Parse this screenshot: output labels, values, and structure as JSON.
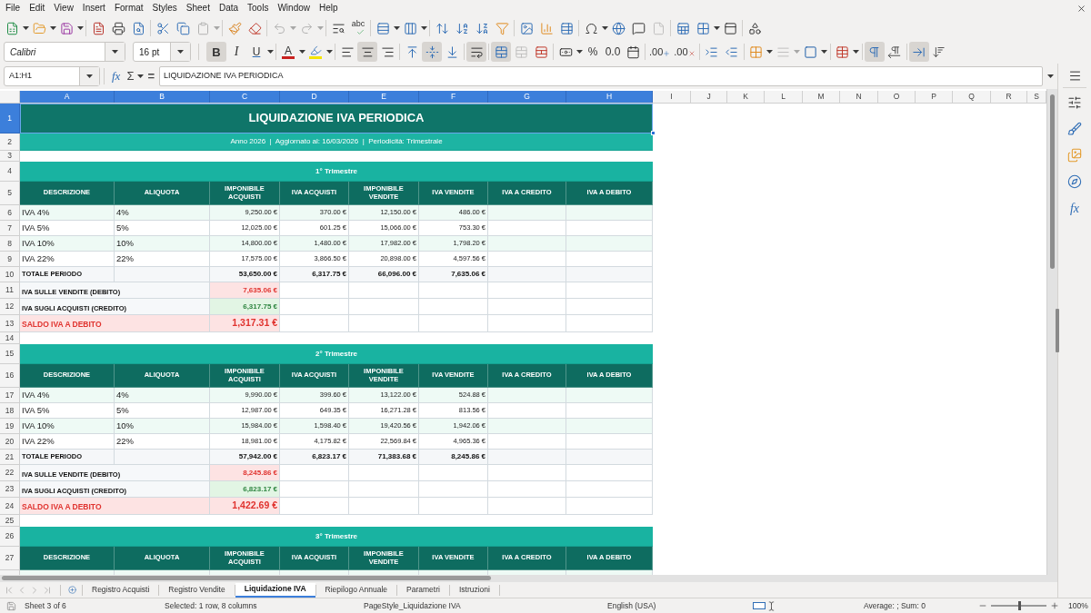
{
  "menu": [
    "File",
    "Edit",
    "View",
    "Insert",
    "Format",
    "Styles",
    "Sheet",
    "Data",
    "Tools",
    "Window",
    "Help"
  ],
  "standard_toolbar": [
    [
      {
        "kind": "new",
        "dropdown": true,
        "disabled": false
      },
      {
        "kind": "open",
        "dropdown": true,
        "disabled": false
      },
      {
        "kind": "save",
        "dropdown": true,
        "disabled": false
      }
    ],
    [
      {
        "kind": "export_pdf",
        "disabled": false
      },
      {
        "kind": "print",
        "disabled": false
      },
      {
        "kind": "print_preview",
        "disabled": false
      }
    ],
    [
      {
        "kind": "cut",
        "disabled": false
      },
      {
        "kind": "copy",
        "disabled": false
      },
      {
        "kind": "paste",
        "dropdown": true,
        "disabled": true
      }
    ],
    [
      {
        "kind": "clone_formatting",
        "disabled": false
      },
      {
        "kind": "clear_formatting",
        "disabled": false
      }
    ],
    [
      {
        "kind": "undo",
        "dropdown": true,
        "disabled": true
      },
      {
        "kind": "redo",
        "dropdown": true,
        "disabled": true
      }
    ],
    [
      {
        "kind": "find_replace",
        "disabled": false
      },
      {
        "kind": "spelling",
        "label": "abc",
        "disabled": false
      }
    ],
    [
      {
        "kind": "rows",
        "dropdown": true,
        "disabled": false
      },
      {
        "kind": "columns",
        "dropdown": true,
        "disabled": false
      }
    ],
    [
      {
        "kind": "sort",
        "disabled": false
      },
      {
        "kind": "sort_ascending",
        "disabled": false
      },
      {
        "kind": "sort_descending",
        "disabled": false
      },
      {
        "kind": "autofilter",
        "disabled": false
      }
    ],
    [
      {
        "kind": "image",
        "disabled": false
      },
      {
        "kind": "chart",
        "disabled": false
      },
      {
        "kind": "pivot_table",
        "disabled": false
      }
    ],
    [
      {
        "kind": "special_character",
        "dropdown": true,
        "disabled": false
      },
      {
        "kind": "hyperlink",
        "disabled": false
      },
      {
        "kind": "comment",
        "disabled": false
      },
      {
        "kind": "header_footer",
        "disabled": true
      }
    ],
    [
      {
        "kind": "print_area",
        "disabled": false
      },
      {
        "kind": "freeze",
        "dropdown": true,
        "disabled": false
      },
      {
        "kind": "split_window",
        "disabled": false
      }
    ],
    [
      {
        "kind": "shapes",
        "disabled": false
      }
    ]
  ],
  "format_toolbar": {
    "font_name": "Calibri",
    "font_size": "16 pt",
    "groups": [
      [
        {
          "kind": "bold",
          "label": "B",
          "active": true,
          "disabled": false
        },
        {
          "kind": "italic",
          "label": "I",
          "active": false,
          "disabled": false
        },
        {
          "kind": "underline",
          "label": "U",
          "active": false,
          "disabled": false,
          "dropdown": true
        }
      ],
      [
        {
          "kind": "font_color",
          "label": "A",
          "active": false,
          "disabled": false,
          "dropdown": true
        },
        {
          "kind": "highlight",
          "active": false,
          "disabled": false,
          "dropdown": true
        }
      ],
      [
        {
          "kind": "align_left",
          "active": false,
          "disabled": false
        },
        {
          "kind": "align_center",
          "active": true,
          "disabled": false
        },
        {
          "kind": "align_right",
          "active": false,
          "disabled": false
        }
      ],
      [
        {
          "kind": "align_top",
          "active": false,
          "disabled": false
        },
        {
          "kind": "align_middle",
          "active": true,
          "disabled": false
        },
        {
          "kind": "align_bottom",
          "active": false,
          "disabled": false
        }
      ],
      [
        {
          "kind": "wrap_text",
          "active": true,
          "disabled": false
        }
      ],
      [
        {
          "kind": "merge_center",
          "active": true,
          "disabled": false
        },
        {
          "kind": "merge_cells",
          "active": false,
          "disabled": true
        },
        {
          "kind": "unmerge_cells",
          "active": false,
          "disabled": false
        }
      ],
      [
        {
          "kind": "currency",
          "active": false,
          "disabled": false,
          "dropdown": true
        },
        {
          "kind": "percent",
          "label": "%",
          "active": false,
          "disabled": false
        },
        {
          "kind": "number",
          "label": "0.0",
          "active": false,
          "disabled": false
        },
        {
          "kind": "date",
          "active": false,
          "disabled": false
        }
      ],
      [
        {
          "kind": "add_decimal",
          "label": ".00",
          "active": false,
          "disabled": false
        },
        {
          "kind": "delete_decimal",
          "label": ".00",
          "active": false,
          "disabled": false
        }
      ],
      [
        {
          "kind": "indent",
          "active": false,
          "disabled": false
        },
        {
          "kind": "outdent",
          "active": false,
          "disabled": false
        }
      ],
      [
        {
          "kind": "borders",
          "active": false,
          "disabled": false,
          "dropdown": true
        },
        {
          "kind": "border_style",
          "active": false,
          "disabled": true,
          "dropdown": true
        },
        {
          "kind": "border_color",
          "active": false,
          "disabled": false,
          "dropdown": true
        }
      ],
      [
        {
          "kind": "conditional",
          "active": false,
          "disabled": false,
          "dropdown": true
        }
      ],
      [
        {
          "kind": "left_to_right",
          "active": true,
          "disabled": false
        },
        {
          "kind": "right_to_left",
          "active": false,
          "disabled": false
        }
      ],
      [
        {
          "kind": "text_left_to_right",
          "active": true,
          "disabled": false
        },
        {
          "kind": "text_top_to_bottom",
          "active": false,
          "disabled": false
        }
      ]
    ]
  },
  "formula_bar": {
    "name_box": "A1:H1",
    "wizard_label": "fx",
    "sum_label": "Σ",
    "equals_label": "=",
    "content": "LIQUIDAZIONE IVA PERIODICA"
  },
  "sheet": {
    "column_headers": [
      {
        "label": "A",
        "selected": true
      },
      {
        "label": "B",
        "selected": true
      },
      {
        "label": "C",
        "selected": true
      },
      {
        "label": "D",
        "selected": true
      },
      {
        "label": "E",
        "selected": true
      },
      {
        "label": "F",
        "selected": true
      },
      {
        "label": "G",
        "selected": true
      },
      {
        "label": "H",
        "selected": true
      },
      {
        "label": "I",
        "selected": false
      },
      {
        "label": "J",
        "selected": false
      },
      {
        "label": "K",
        "selected": false
      },
      {
        "label": "L",
        "selected": false
      },
      {
        "label": "M",
        "selected": false
      },
      {
        "label": "N",
        "selected": false
      },
      {
        "label": "O",
        "selected": false
      },
      {
        "label": "P",
        "selected": false
      },
      {
        "label": "Q",
        "selected": false
      },
      {
        "label": "R",
        "selected": false
      },
      {
        "label": "S",
        "selected": false
      }
    ],
    "row_headers": [
      {
        "label": "1",
        "selected": true
      },
      {
        "label": "2",
        "selected": false
      },
      {
        "label": "3",
        "selected": false
      },
      {
        "label": "4",
        "selected": false
      },
      {
        "label": "5",
        "selected": false
      },
      {
        "label": "6",
        "selected": false
      },
      {
        "label": "7",
        "selected": false
      },
      {
        "label": "8",
        "selected": false
      },
      {
        "label": "9",
        "selected": false
      },
      {
        "label": "10",
        "selected": false
      },
      {
        "label": "11",
        "selected": false
      },
      {
        "label": "12",
        "selected": false
      },
      {
        "label": "13",
        "selected": false
      },
      {
        "label": "14",
        "selected": false
      },
      {
        "label": "15",
        "selected": false
      },
      {
        "label": "16",
        "selected": false
      },
      {
        "label": "17",
        "selected": false
      },
      {
        "label": "18",
        "selected": false
      },
      {
        "label": "19",
        "selected": false
      },
      {
        "label": "20",
        "selected": false
      },
      {
        "label": "21",
        "selected": false
      },
      {
        "label": "22",
        "selected": false
      },
      {
        "label": "23",
        "selected": false
      },
      {
        "label": "24",
        "selected": false
      },
      {
        "label": "25",
        "selected": false
      },
      {
        "label": "26",
        "selected": false
      },
      {
        "label": "27",
        "selected": false
      }
    ],
    "title": "LIQUIDAZIONE IVA PERIODICA",
    "subtitle": "Anno 2026  |  Aggiornato al: 16/03/2026  |  Periodicità: Trimestrale",
    "quarters": [
      {
        "title": "1° Trimestre",
        "columns": [
          "DESCRIZIONE",
          "ALIQUOTA",
          "IMPONIBILE ACQUISTI",
          "IVA ACQUISTI",
          "IMPONIBILE VENDITE",
          "IVA VENDITE",
          "IVA A CREDITO",
          "IVA A DEBITO"
        ],
        "rows": [
          [
            "IVA 4%",
            "4%",
            "9,250.00 €",
            "370.00 €",
            "12,150.00 €",
            "486.00 €"
          ],
          [
            "IVA 5%",
            "5%",
            "12,025.00 €",
            "601.25 €",
            "15,066.00 €",
            "753.30 €"
          ],
          [
            "IVA 10%",
            "10%",
            "14,800.00 €",
            "1,480.00 €",
            "17,982.00 €",
            "1,798.20 €"
          ],
          [
            "IVA 22%",
            "22%",
            "17,575.00 €",
            "3,866.50 €",
            "20,898.00 €",
            "4,597.56 €"
          ]
        ],
        "total": {
          "label": "TOTALE PERIODO",
          "values": [
            "53,650.00 €",
            "6,317.75 €",
            "66,096.00 €",
            "7,635.06 €"
          ]
        },
        "summary": [
          {
            "kind": "debit",
            "label": "IVA SULLE VENDITE (DEBITO)",
            "value": "7,635.06 €"
          },
          {
            "kind": "credit",
            "label": "IVA SUGLI ACQUISTI (CREDITO)",
            "value": "6,317.75 €"
          },
          {
            "kind": "balance",
            "label": "SALDO IVA A DEBITO",
            "value": "1,317.31 €"
          }
        ]
      },
      {
        "title": "2° Trimestre",
        "columns": [
          "DESCRIZIONE",
          "ALIQUOTA",
          "IMPONIBILE ACQUISTI",
          "IVA ACQUISTI",
          "IMPONIBILE VENDITE",
          "IVA VENDITE",
          "IVA A CREDITO",
          "IVA A DEBITO"
        ],
        "rows": [
          [
            "IVA 4%",
            "4%",
            "9,990.00 €",
            "399.60 €",
            "13,122.00 €",
            "524.88 €"
          ],
          [
            "IVA 5%",
            "5%",
            "12,987.00 €",
            "649.35 €",
            "16,271.28 €",
            "813.56 €"
          ],
          [
            "IVA 10%",
            "10%",
            "15,984.00 €",
            "1,598.40 €",
            "19,420.56 €",
            "1,942.06 €"
          ],
          [
            "IVA 22%",
            "22%",
            "18,981.00 €",
            "4,175.82 €",
            "22,569.84 €",
            "4,965.36 €"
          ]
        ],
        "total": {
          "label": "TOTALE PERIODO",
          "values": [
            "57,942.00 €",
            "6,823.17 €",
            "71,383.68 €",
            "8,245.86 €"
          ]
        },
        "summary": [
          {
            "kind": "debit",
            "label": "IVA SULLE VENDITE (DEBITO)",
            "value": "8,245.86 €"
          },
          {
            "kind": "credit",
            "label": "IVA SUGLI ACQUISTI (CREDITO)",
            "value": "6,823.17 €"
          },
          {
            "kind": "balance",
            "label": "SALDO IVA A DEBITO",
            "value": "1,422.69 €"
          }
        ]
      },
      {
        "title": "3° Trimestre",
        "columns": [
          "DESCRIZIONE",
          "ALIQUOTA",
          "IMPONIBILE ACQUISTI",
          "IVA ACQUISTI",
          "IMPONIBILE VENDITE",
          "IVA VENDITE",
          "IVA A CREDITO",
          "IVA A DEBITO"
        ]
      }
    ]
  },
  "sheet_tabs": [
    {
      "label": "Registro Acquisti",
      "selected": false
    },
    {
      "label": "Registro Vendite",
      "selected": false
    },
    {
      "label": "Liquidazione IVA",
      "selected": true
    },
    {
      "label": "Riepilogo Annuale",
      "selected": false
    },
    {
      "label": "Parametri",
      "selected": false
    },
    {
      "label": "Istruzioni",
      "selected": false
    }
  ],
  "sidebar": {
    "tabs": [
      {
        "kind": "properties"
      },
      {
        "kind": "styles"
      },
      {
        "kind": "gallery"
      },
      {
        "kind": "navigator"
      },
      {
        "kind": "functions",
        "label": "fx"
      }
    ]
  },
  "status_bar": {
    "sheet": "Sheet 3 of 6",
    "selection": "Selected: 1 row, 8 columns",
    "page_style": "PageStyle_Liquidazione IVA",
    "language": "English (USA)",
    "summary": "Average: ; Sum: 0",
    "zoom": {
      "level": 0.5,
      "reading": "100%"
    }
  }
}
